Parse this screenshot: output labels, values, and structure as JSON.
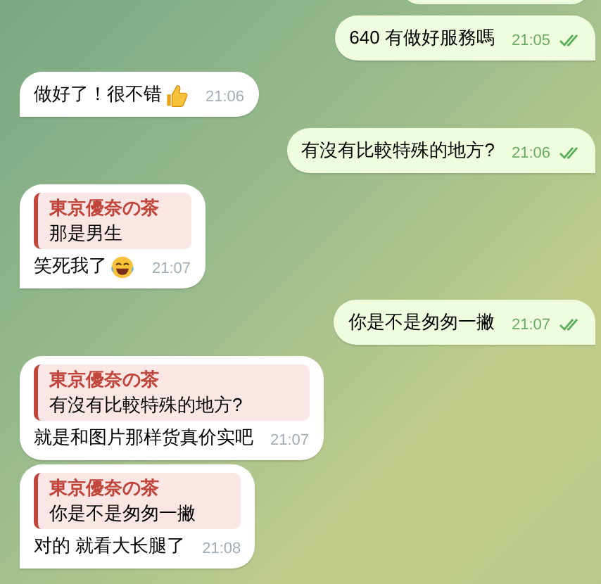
{
  "messages": [
    {
      "outgoing": true
    },
    {
      "outgoing": true,
      "text": "640 有做好服務嗎",
      "time": "21:05",
      "read": true
    },
    {
      "outgoing": false,
      "text": "做好了！很不错",
      "emoji": {
        "kind": "thumbs-up"
      },
      "time": "21:06"
    },
    {
      "outgoing": true,
      "text": "有沒有比較特殊的地方?",
      "time": "21:06",
      "read": true
    },
    {
      "outgoing": false,
      "reply": {
        "author": "東京優奈の茶",
        "text": "那是男生"
      },
      "text": "笑死我了",
      "emoji": {
        "kind": "laughing"
      },
      "time": "21:07"
    },
    {
      "outgoing": true,
      "text": "你是不是匆匆一撇",
      "time": "21:07",
      "read": true
    },
    {
      "outgoing": false,
      "reply": {
        "author": "東京優奈の茶",
        "text": "有沒有比較特殊的地方?"
      },
      "text": "就是和图片那样货真价实吧",
      "time": "21:07"
    },
    {
      "outgoing": false,
      "reply": {
        "author": "東京優奈の茶",
        "text": "你是不是匆匆一撇"
      },
      "text": "对的 就看大长腿了",
      "time": "21:08"
    }
  ]
}
